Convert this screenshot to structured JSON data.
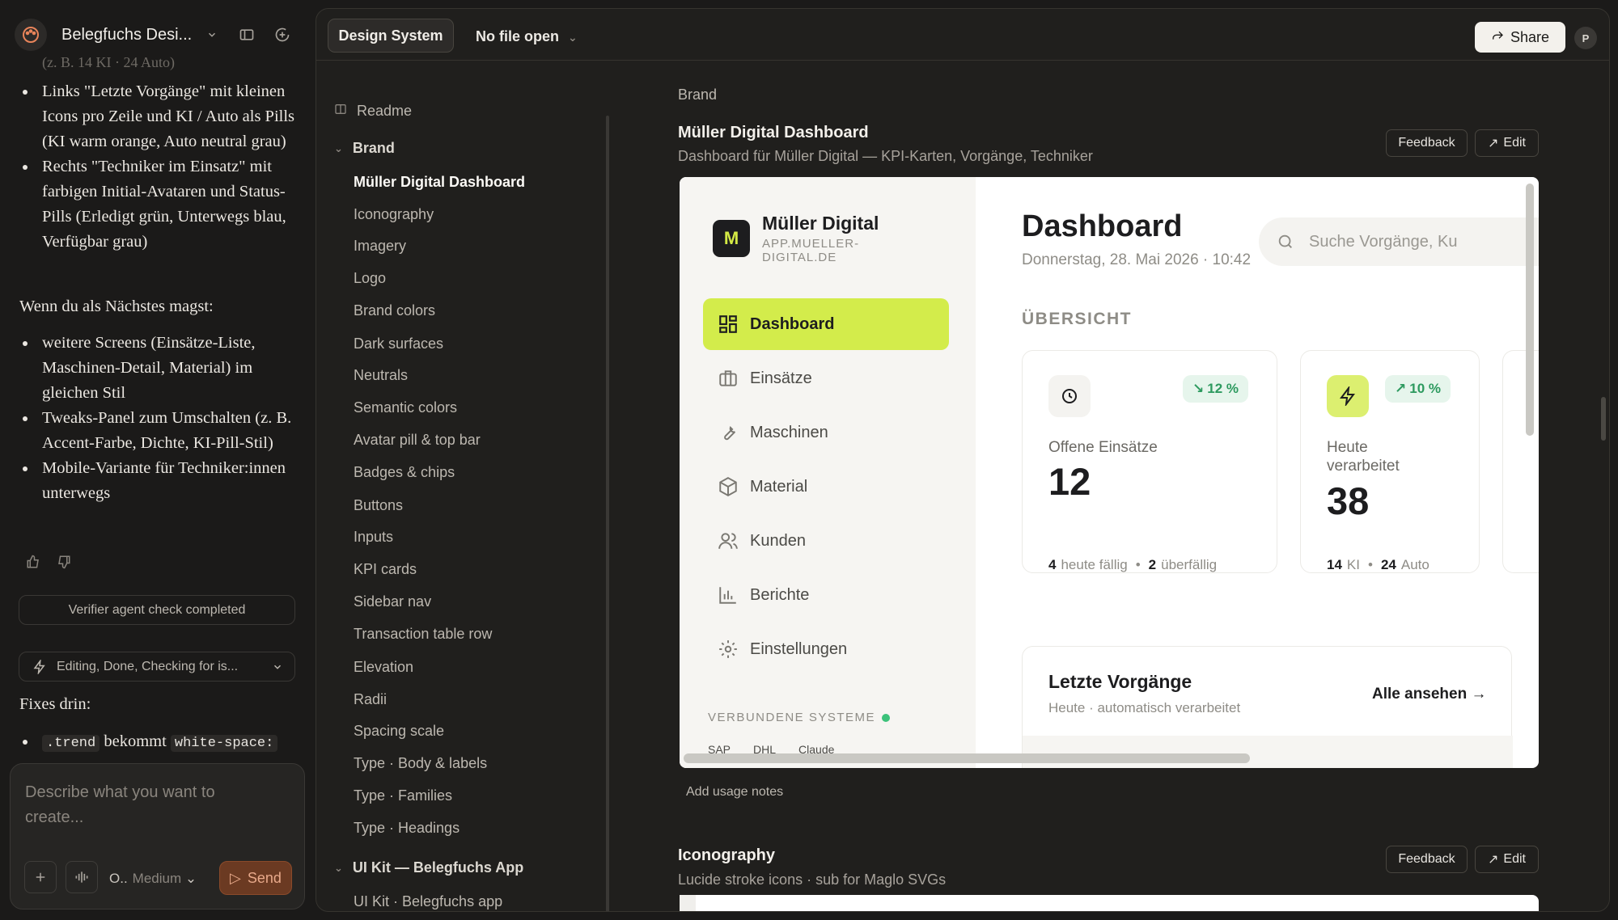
{
  "chat": {
    "project_title": "Belegfuchs Desi...",
    "faded_line": "(z. B. 14 KI · 24 Auto)",
    "bullets_a": [
      "Links \"Letzte Vorgänge\" mit kleinen Icons pro Zeile und KI / Auto als Pills (KI warm orange, Auto neutral grau)",
      "Rechts \"Techniker im Einsatz\" mit farbigen Initial-Avataren und Status-Pills (Erledigt grün, Unterwegs blau, Verfügbar grau)"
    ],
    "next_intro": "Wenn du als Nächstes magst:",
    "bullets_b": [
      "weitere Screens (Einsätze-Liste, Maschinen-Detail, Material) im gleichen Stil",
      "Tweaks-Panel zum Umschalten (z. B. Accent-Farbe, Dichte, KI-Pill-Stil)",
      "Mobile-Variante für Techniker:innen unterwegs"
    ],
    "verifier": "Verifier agent check completed",
    "status_pill": "Editing, Done, Checking for is...",
    "fixes_heading": "Fixes drin:",
    "fix_code1": ".trend",
    "fix_text": "bekommt",
    "fix_code2": "white-space:",
    "composer_placeholder": "Describe what you want to create...",
    "model": "O..",
    "effort": "Medium",
    "send": "Send"
  },
  "topbar": {
    "tab": "Design System",
    "file": "No file open",
    "share": "Share",
    "avatar": "P"
  },
  "nav": {
    "readme": "Readme",
    "brand_section": "Brand",
    "brand_items": [
      "Müller Digital Dashboard",
      "Iconography",
      "Imagery",
      "Logo",
      "Brand colors",
      "Dark surfaces",
      "Neutrals",
      "Semantic colors",
      "Avatar pill & top bar",
      "Badges & chips",
      "Buttons",
      "Inputs",
      "KPI cards",
      "Sidebar nav",
      "Transaction table row",
      "Elevation",
      "Radii",
      "Spacing scale",
      "Type · Body & labels",
      "Type · Families",
      "Type · Headings"
    ],
    "uikit_section": "UI Kit — Belegfuchs App",
    "uikit_items": [
      "UI Kit · Belegfuchs app"
    ]
  },
  "content": {
    "crumb": "Brand",
    "card1": {
      "title": "Müller Digital Dashboard",
      "subtitle": "Dashboard für Müller Digital — KPI-Karten, Vorgänge, Techniker",
      "feedback": "Feedback",
      "edit": "Edit"
    },
    "usage": "Add usage notes",
    "card2": {
      "title": "Iconography",
      "subtitle": "Lucide stroke icons · sub for Maglo SVGs",
      "feedback": "Feedback",
      "edit": "Edit"
    }
  },
  "preview": {
    "logo_letter": "M",
    "brand_name": "Müller Digital",
    "brand_url": "APP.MUELLER-DIGITAL.DE",
    "nav": [
      "Dashboard",
      "Einsätze",
      "Maschinen",
      "Material",
      "Kunden",
      "Berichte",
      "Einstellungen"
    ],
    "connected": "VERBUNDENE SYSTEME",
    "chips": [
      "SAP",
      "DHL",
      "Claude"
    ],
    "title": "Dashboard",
    "date": "Donnerstag, 28. Mai 2026 · 10:42",
    "search_placeholder": "Suche Vorgänge, Ku",
    "overview": "ÜBERSICHT",
    "kpi1": {
      "label": "Offene Einsätze",
      "value": "12",
      "trend": "12 %",
      "f1n": "4",
      "f1t": "heute fällig",
      "f2n": "2",
      "f2t": "überfällig"
    },
    "kpi2": {
      "label": "Heute verarbeitet",
      "value": "38",
      "trend": "10 %",
      "f1n": "14",
      "f1t": "KI",
      "f2n": "24",
      "f2t": "Auto"
    },
    "recent_title": "Letzte Vorgänge",
    "recent_sub": "Heute · automatisch verarbeitet",
    "view_all": "Alle ansehen"
  },
  "colors": {
    "accent": "#d3ec4b",
    "trend_green": "#2d9a5f",
    "send": "#6b3a22"
  }
}
